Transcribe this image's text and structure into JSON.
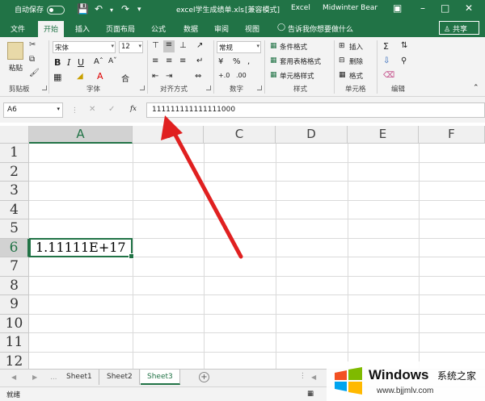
{
  "titlebar": {
    "autosave_label": "自动保存",
    "autosave_state": "off",
    "doc_title": "excel学生成绩单.xls",
    "compat_mode": "[兼容模式]",
    "app_name": "Excel",
    "user_name": "Midwinter Bear"
  },
  "tabs": [
    "文件",
    "开始",
    "插入",
    "页面布局",
    "公式",
    "数据",
    "审阅",
    "视图"
  ],
  "active_tab": "开始",
  "tell_me": "告诉我你想要做什么",
  "share_label": "共享",
  "ribbon": {
    "clipboard": {
      "paste": "粘贴",
      "group": "剪贴板"
    },
    "font": {
      "name": "宋体",
      "size": "12",
      "group": "字体"
    },
    "alignment": {
      "group": "对齐方式"
    },
    "number": {
      "format": "常规",
      "group": "数字"
    },
    "styles": {
      "conditional": "条件格式",
      "table": "套用表格格式",
      "cell_styles": "单元格样式",
      "group": "样式"
    },
    "cells": {
      "insert": "插入",
      "delete": "删除",
      "format": "格式",
      "group": "单元格"
    },
    "editing": {
      "group": "编辑"
    }
  },
  "formula_bar": {
    "name_box": "A6",
    "fx": "fx",
    "value": "111111111111111000"
  },
  "grid": {
    "columns": [
      "A",
      "B",
      "C",
      "D",
      "E",
      "F"
    ],
    "rows": [
      "1",
      "2",
      "3",
      "4",
      "5",
      "6",
      "7",
      "8",
      "9",
      "10",
      "11",
      "12"
    ],
    "active_cell": "A6",
    "cell_A6_display": "1.11111E+17"
  },
  "sheets": [
    "Sheet1",
    "Sheet2",
    "Sheet3"
  ],
  "active_sheet": "Sheet3",
  "status": {
    "ready": "就绪"
  },
  "watermark": {
    "brand": "Windows",
    "cn": "系统之家",
    "url": "www.bjjmlv.com"
  },
  "colors": {
    "excel_green": "#217346",
    "arrow_red": "#e02020"
  }
}
